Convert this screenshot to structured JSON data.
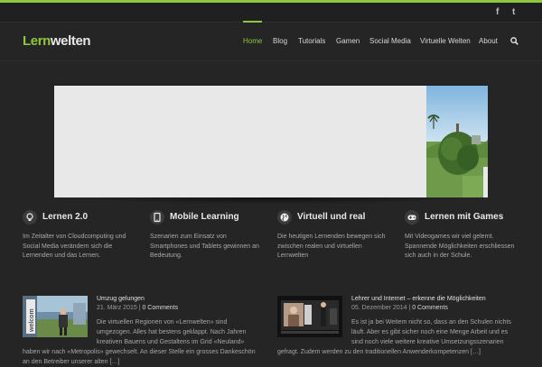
{
  "colors": {
    "accent": "#8ec63f",
    "background": "#252525",
    "text": "#cfcfcf"
  },
  "topbar": {
    "social": [
      {
        "icon": "facebook-icon",
        "glyph": "f"
      },
      {
        "icon": "twitter-icon",
        "glyph": "t"
      }
    ]
  },
  "header": {
    "logo": {
      "part1": "Lern",
      "part2": "welten"
    },
    "nav": [
      {
        "label": "Home",
        "active": true
      },
      {
        "label": "Blog"
      },
      {
        "label": "Tutorials"
      },
      {
        "label": "Gamen"
      },
      {
        "label": "Social Media"
      },
      {
        "label": "Virtuelle Welten"
      },
      {
        "label": "About"
      }
    ],
    "search_icon": "search-icon"
  },
  "features": [
    {
      "icon": "lightbulb-icon",
      "title": "Lernen 2.0",
      "text": "Im Zeitalter von Cloudcomputing und Social Media verändern sich die Lernenden und das Lernen."
    },
    {
      "icon": "tablet-icon",
      "title": "Mobile Learning",
      "text": "Szenarien zum Einsatz von Smartphones und Tablets gewinnen an Bedeutung."
    },
    {
      "icon": "globe-icon",
      "title": "Virtuell und real",
      "text": "Die heutigen Lernenden bewegen sich zwischen realen und virtuellen Lernwelten"
    },
    {
      "icon": "gamepad-icon",
      "title": "Lernen mit Games",
      "text": "Mit Videogames wir viel gelernt. Spannende Möglichkeiten erschliessen sich auch in der Schule."
    }
  ],
  "posts": [
    {
      "title": "Umzug gelungen",
      "date": "21. März 2015",
      "comments": "0 Comments",
      "thumb_text": "welcom",
      "excerpt_lines": [
        "Die virtuellen Regionen von «Lernwelten» sind",
        "umgezogen. Alles hat bestens geklappt. Nach Jahren",
        "kreativen Bauens und Gestaltens im Grid «Neuland»",
        "haben wir nach «Metropolis» gewechselt. An dieser Stelle ein grosses Dankeschön",
        "an den Betreiber unserer alten […]"
      ]
    },
    {
      "title": "Lehrer und Internet – erkenne die Möglichkeiten",
      "date": "05. Dezember 2014",
      "comments": "0 Comments",
      "excerpt_lines": [
        "Es ist ja bei Weitem nicht so, dass an den Schulen nichts",
        "läuft. Aber es gibt sicher noch eine Menge Arbeit und es",
        "sind noch viele weitere kreative Umsetzungsszenarien",
        "gefragt. Zudem werden zu den traditionellen Anwenderkompetenzen […]"
      ]
    }
  ]
}
